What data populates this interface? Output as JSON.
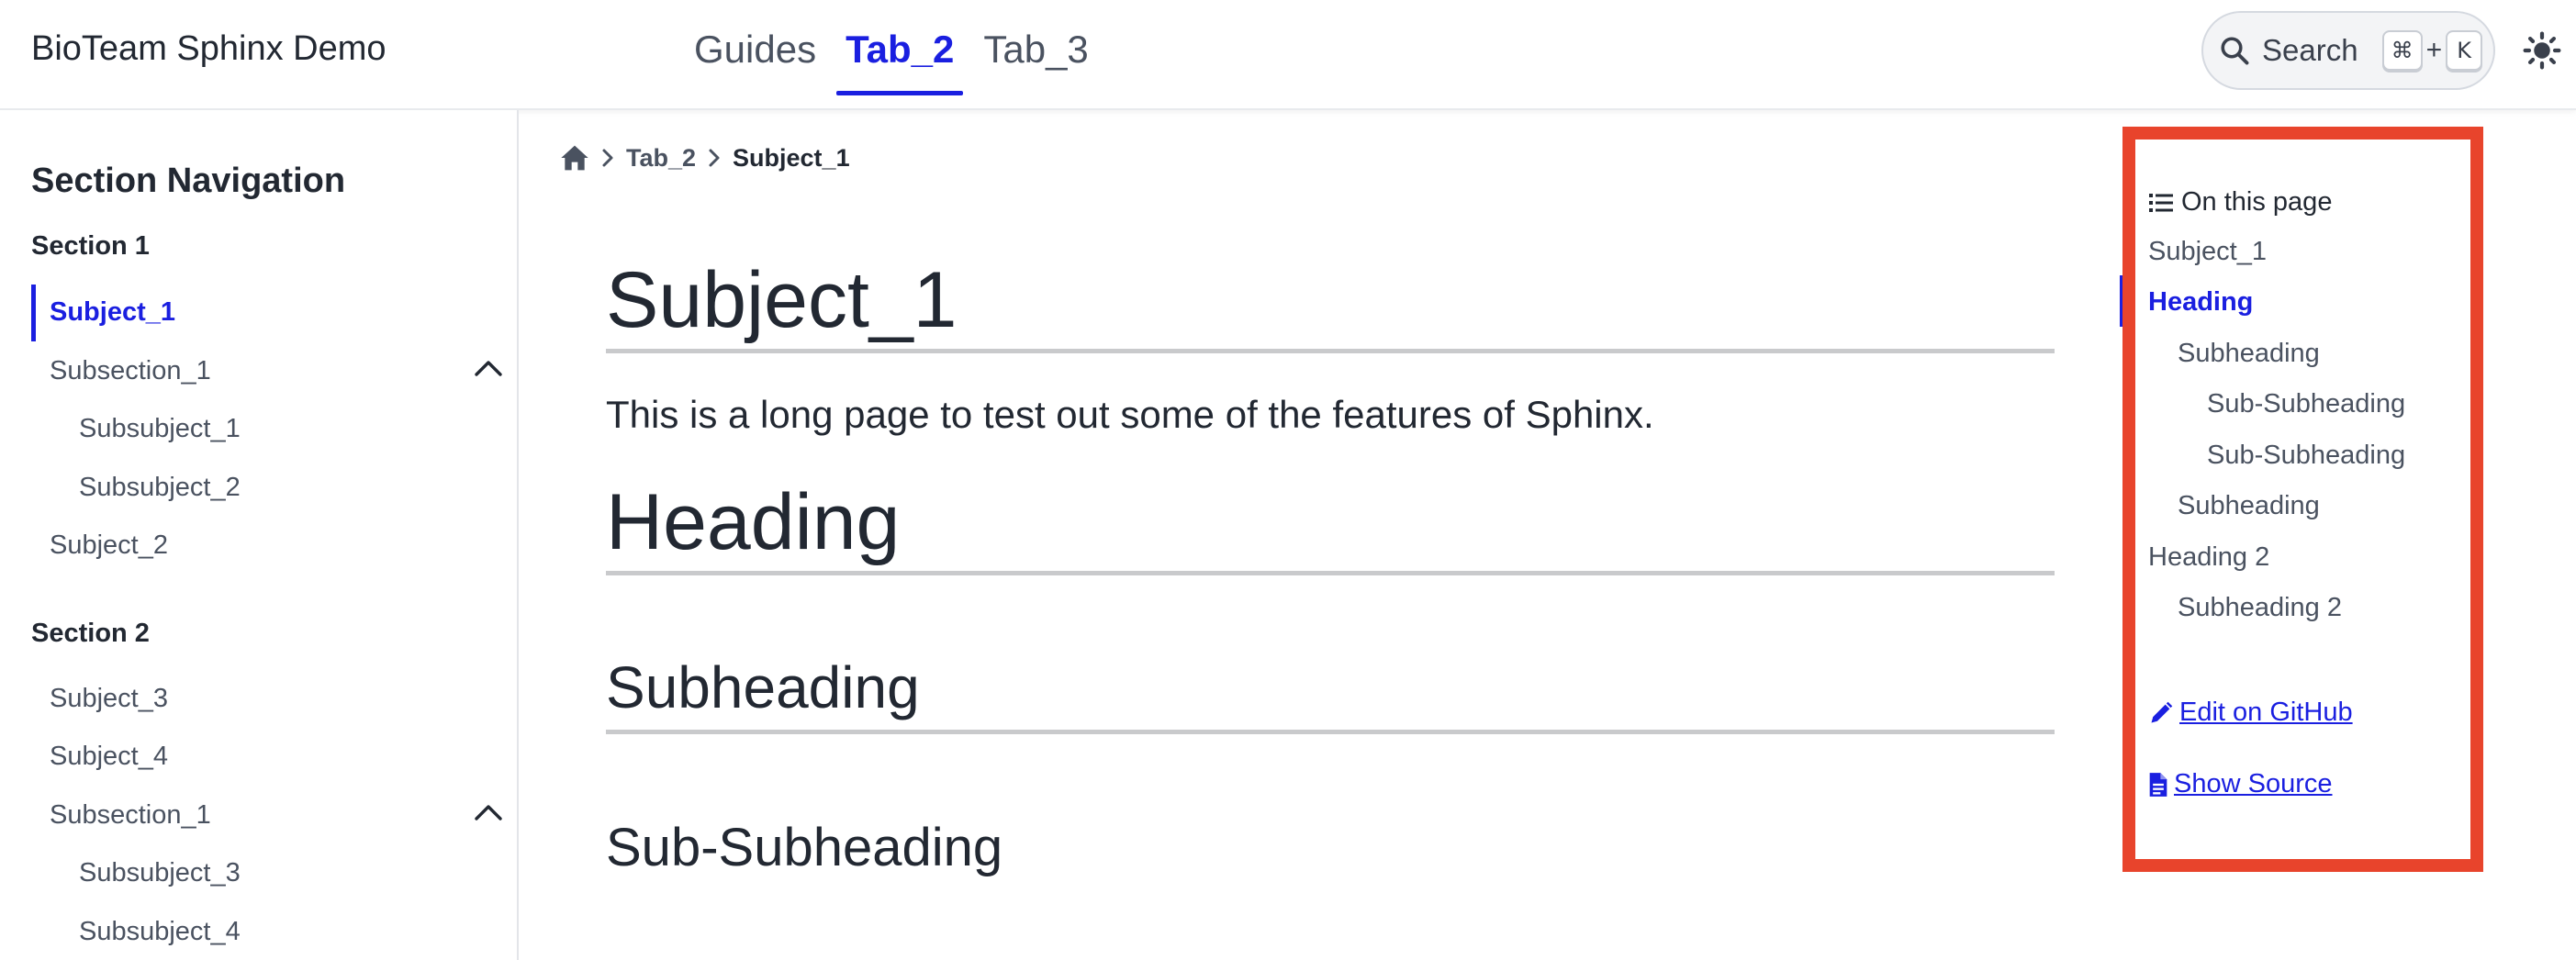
{
  "header": {
    "brand": "BioTeam Sphinx Demo",
    "tabs": [
      {
        "label": "Guides",
        "active": false
      },
      {
        "label": "Tab_2",
        "active": true
      },
      {
        "label": "Tab_3",
        "active": false
      }
    ],
    "search": {
      "label": "Search",
      "shortcut_key1": "⌘",
      "shortcut_plus": "+",
      "shortcut_key2": "K"
    },
    "theme_icon": "sun-icon"
  },
  "sidebar": {
    "title": "Section Navigation",
    "sections": [
      {
        "caption": "Section 1",
        "items": [
          {
            "label": "Subject_1",
            "active": true
          },
          {
            "label": "Subsection_1",
            "expanded": true
          },
          {
            "label": "Subsubject_1"
          },
          {
            "label": "Subsubject_2"
          },
          {
            "label": "Subject_2"
          }
        ]
      },
      {
        "caption": "Section 2",
        "items": [
          {
            "label": "Subject_3"
          },
          {
            "label": "Subject_4"
          },
          {
            "label": "Subsection_1",
            "expanded": true
          },
          {
            "label": "Subsubject_3"
          },
          {
            "label": "Subsubject_4"
          }
        ]
      }
    ]
  },
  "breadcrumb": {
    "home_icon": "home-icon",
    "items": [
      "Tab_2",
      "Subject_1"
    ]
  },
  "content": {
    "title": "Subject_1",
    "intro": "This is a long page to test out some of the features of Sphinx.",
    "heading": "Heading",
    "subheading": "Subheading",
    "subsubheading": "Sub-Subheading"
  },
  "toc": {
    "header": "On this page",
    "items": [
      {
        "label": "Subject_1",
        "level": 0
      },
      {
        "label": "Heading",
        "level": 0,
        "active": true
      },
      {
        "label": "Subheading",
        "level": 1
      },
      {
        "label": "Sub-Subheading",
        "level": 2
      },
      {
        "label": "Sub-Subheading",
        "level": 2
      },
      {
        "label": "Subheading",
        "level": 1
      },
      {
        "label": "Heading 2",
        "level": 0
      },
      {
        "label": "Subheading 2",
        "level": 1
      }
    ],
    "edit_link": "Edit on GitHub",
    "source_link": "Show Source",
    "highlight_color": "#e8442c"
  },
  "colors": {
    "accent": "#1a1fe0",
    "text": "#222832",
    "muted": "#4a5260"
  }
}
